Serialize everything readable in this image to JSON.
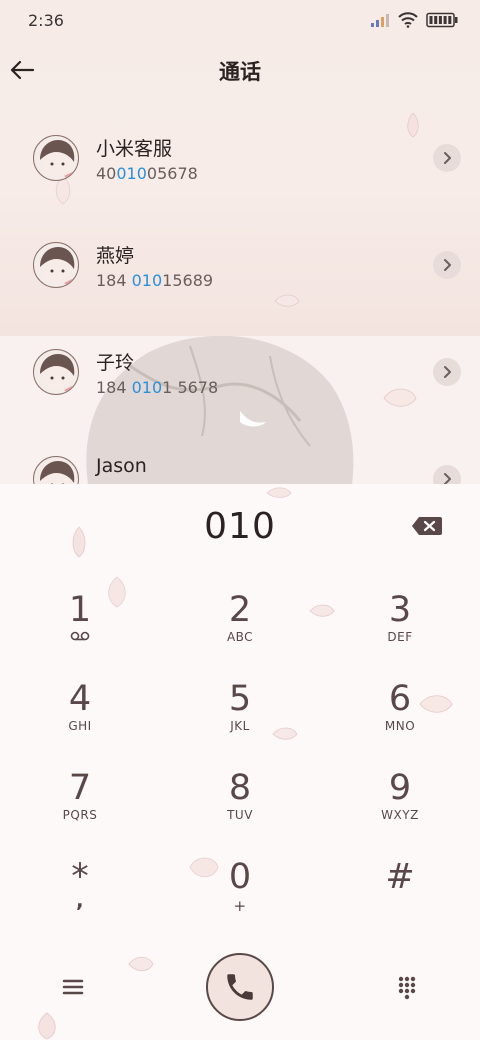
{
  "status_bar": {
    "time": "2:36"
  },
  "header": {
    "title": "通话"
  },
  "contacts": [
    {
      "name": "小米客服",
      "number_pre": "40",
      "number_match": "010",
      "number_post": "05678"
    },
    {
      "name": "燕婷",
      "number_pre": "184 ",
      "number_match": "010",
      "number_post": "15689"
    },
    {
      "name": "子玲",
      "number_pre": "184 ",
      "number_match": "010",
      "number_post": "1 5678"
    },
    {
      "name": "Jason",
      "number_pre": "",
      "number_match": "",
      "number_post": ""
    }
  ],
  "dialer": {
    "entered_number": "010",
    "keys": [
      {
        "digit": "1",
        "letters": ""
      },
      {
        "digit": "2",
        "letters": "ABC"
      },
      {
        "digit": "3",
        "letters": "DEF"
      },
      {
        "digit": "4",
        "letters": "GHI"
      },
      {
        "digit": "5",
        "letters": "JKL"
      },
      {
        "digit": "6",
        "letters": "MNO"
      },
      {
        "digit": "7",
        "letters": "PQRS"
      },
      {
        "digit": "8",
        "letters": "TUV"
      },
      {
        "digit": "9",
        "letters": "WXYZ"
      },
      {
        "digit": "*",
        "letters": ","
      },
      {
        "digit": "0",
        "letters": "+"
      },
      {
        "digit": "#",
        "letters": ""
      }
    ]
  },
  "icons": {
    "back": "arrow-left-icon",
    "chevron": "chevron-right-icon",
    "backspace": "backspace-icon",
    "voicemail": "voicemail-icon",
    "menu": "menu-icon",
    "call": "phone-icon",
    "keypad_toggle": "dialpad-icon"
  },
  "colors": {
    "highlight": "#2b90d9",
    "text_dark": "#2b2222",
    "key_text": "#5a4848",
    "call_button_fill": "#f3e3df"
  }
}
